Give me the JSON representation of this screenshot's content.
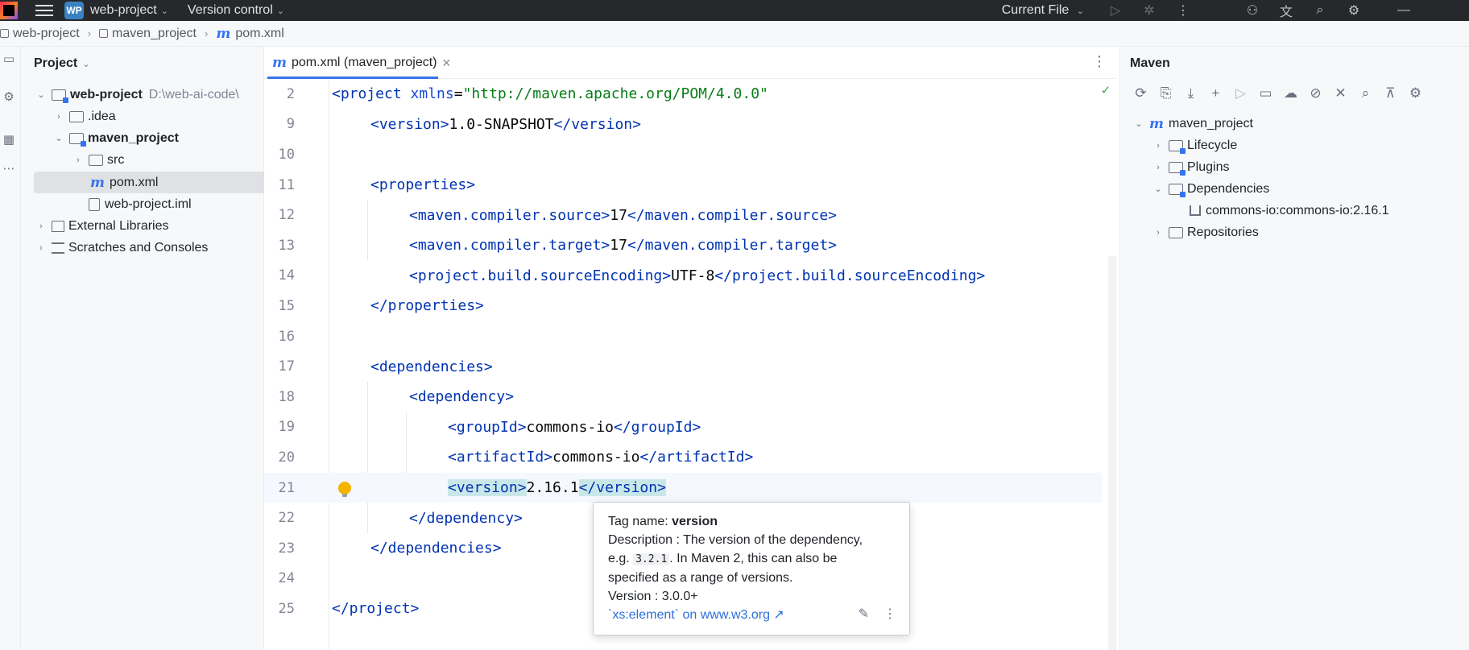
{
  "titlebar": {
    "project_badge": "WP",
    "project_name": "web-project",
    "vcs": "Version control",
    "run_config": "Current File"
  },
  "breadcrumb": [
    "web-project",
    "maven_project",
    "pom.xml"
  ],
  "project_panel": {
    "title": "Project",
    "tree": {
      "root": "web-project",
      "root_path": "D:\\web-ai-code\\",
      "idea": ".idea",
      "maven_project": "maven_project",
      "src": "src",
      "pom": "pom.xml",
      "iml": "web-project.iml",
      "external": "External Libraries",
      "scratches": "Scratches and Consoles"
    }
  },
  "editor": {
    "tab_label": "pom.xml (maven_project)",
    "lines": [
      {
        "n": "2",
        "text": "<project xmlns=\"http://maven.apache.org/POM/4.0.0\""
      },
      {
        "n": "9",
        "text": "    <version>1.0-SNAPSHOT</version>"
      },
      {
        "n": "10",
        "text": ""
      },
      {
        "n": "11",
        "text": "    <properties>"
      },
      {
        "n": "12",
        "text": "        <maven.compiler.source>17</maven.compiler.source>"
      },
      {
        "n": "13",
        "text": "        <maven.compiler.target>17</maven.compiler.target>"
      },
      {
        "n": "14",
        "text": "        <project.build.sourceEncoding>UTF-8</project.build.sourceEncoding>"
      },
      {
        "n": "15",
        "text": "    </properties>"
      },
      {
        "n": "16",
        "text": ""
      },
      {
        "n": "17",
        "text": "    <dependencies>"
      },
      {
        "n": "18",
        "text": "        <dependency>"
      },
      {
        "n": "19",
        "text": "            <groupId>commons-io</groupId>"
      },
      {
        "n": "20",
        "text": "            <artifactId>commons-io</artifactId>"
      },
      {
        "n": "21",
        "text": "            <version>2.16.1</version>"
      },
      {
        "n": "22",
        "text": "        </dependency>"
      },
      {
        "n": "23",
        "text": "    </dependencies>"
      },
      {
        "n": "24",
        "text": ""
      },
      {
        "n": "25",
        "text": "</project>"
      }
    ]
  },
  "tooltip": {
    "tag_label": "Tag name: ",
    "tag_value": "version",
    "desc_1": "Description : The version of the dependency,",
    "desc_2_pre": "e.g. ",
    "desc_2_code": "3.2.1",
    "desc_2_post": ". In Maven 2, this can also be",
    "desc_3": "specified as a range of versions.",
    "version": "Version : 3.0.0+",
    "link": "`xs:element` on www.w3.org ↗"
  },
  "maven_panel": {
    "title": "Maven",
    "tree": {
      "project": "maven_project",
      "lifecycle": "Lifecycle",
      "plugins": "Plugins",
      "dependencies": "Dependencies",
      "dep1": "commons-io:commons-io:2.16.1",
      "repositories": "Repositories"
    }
  }
}
